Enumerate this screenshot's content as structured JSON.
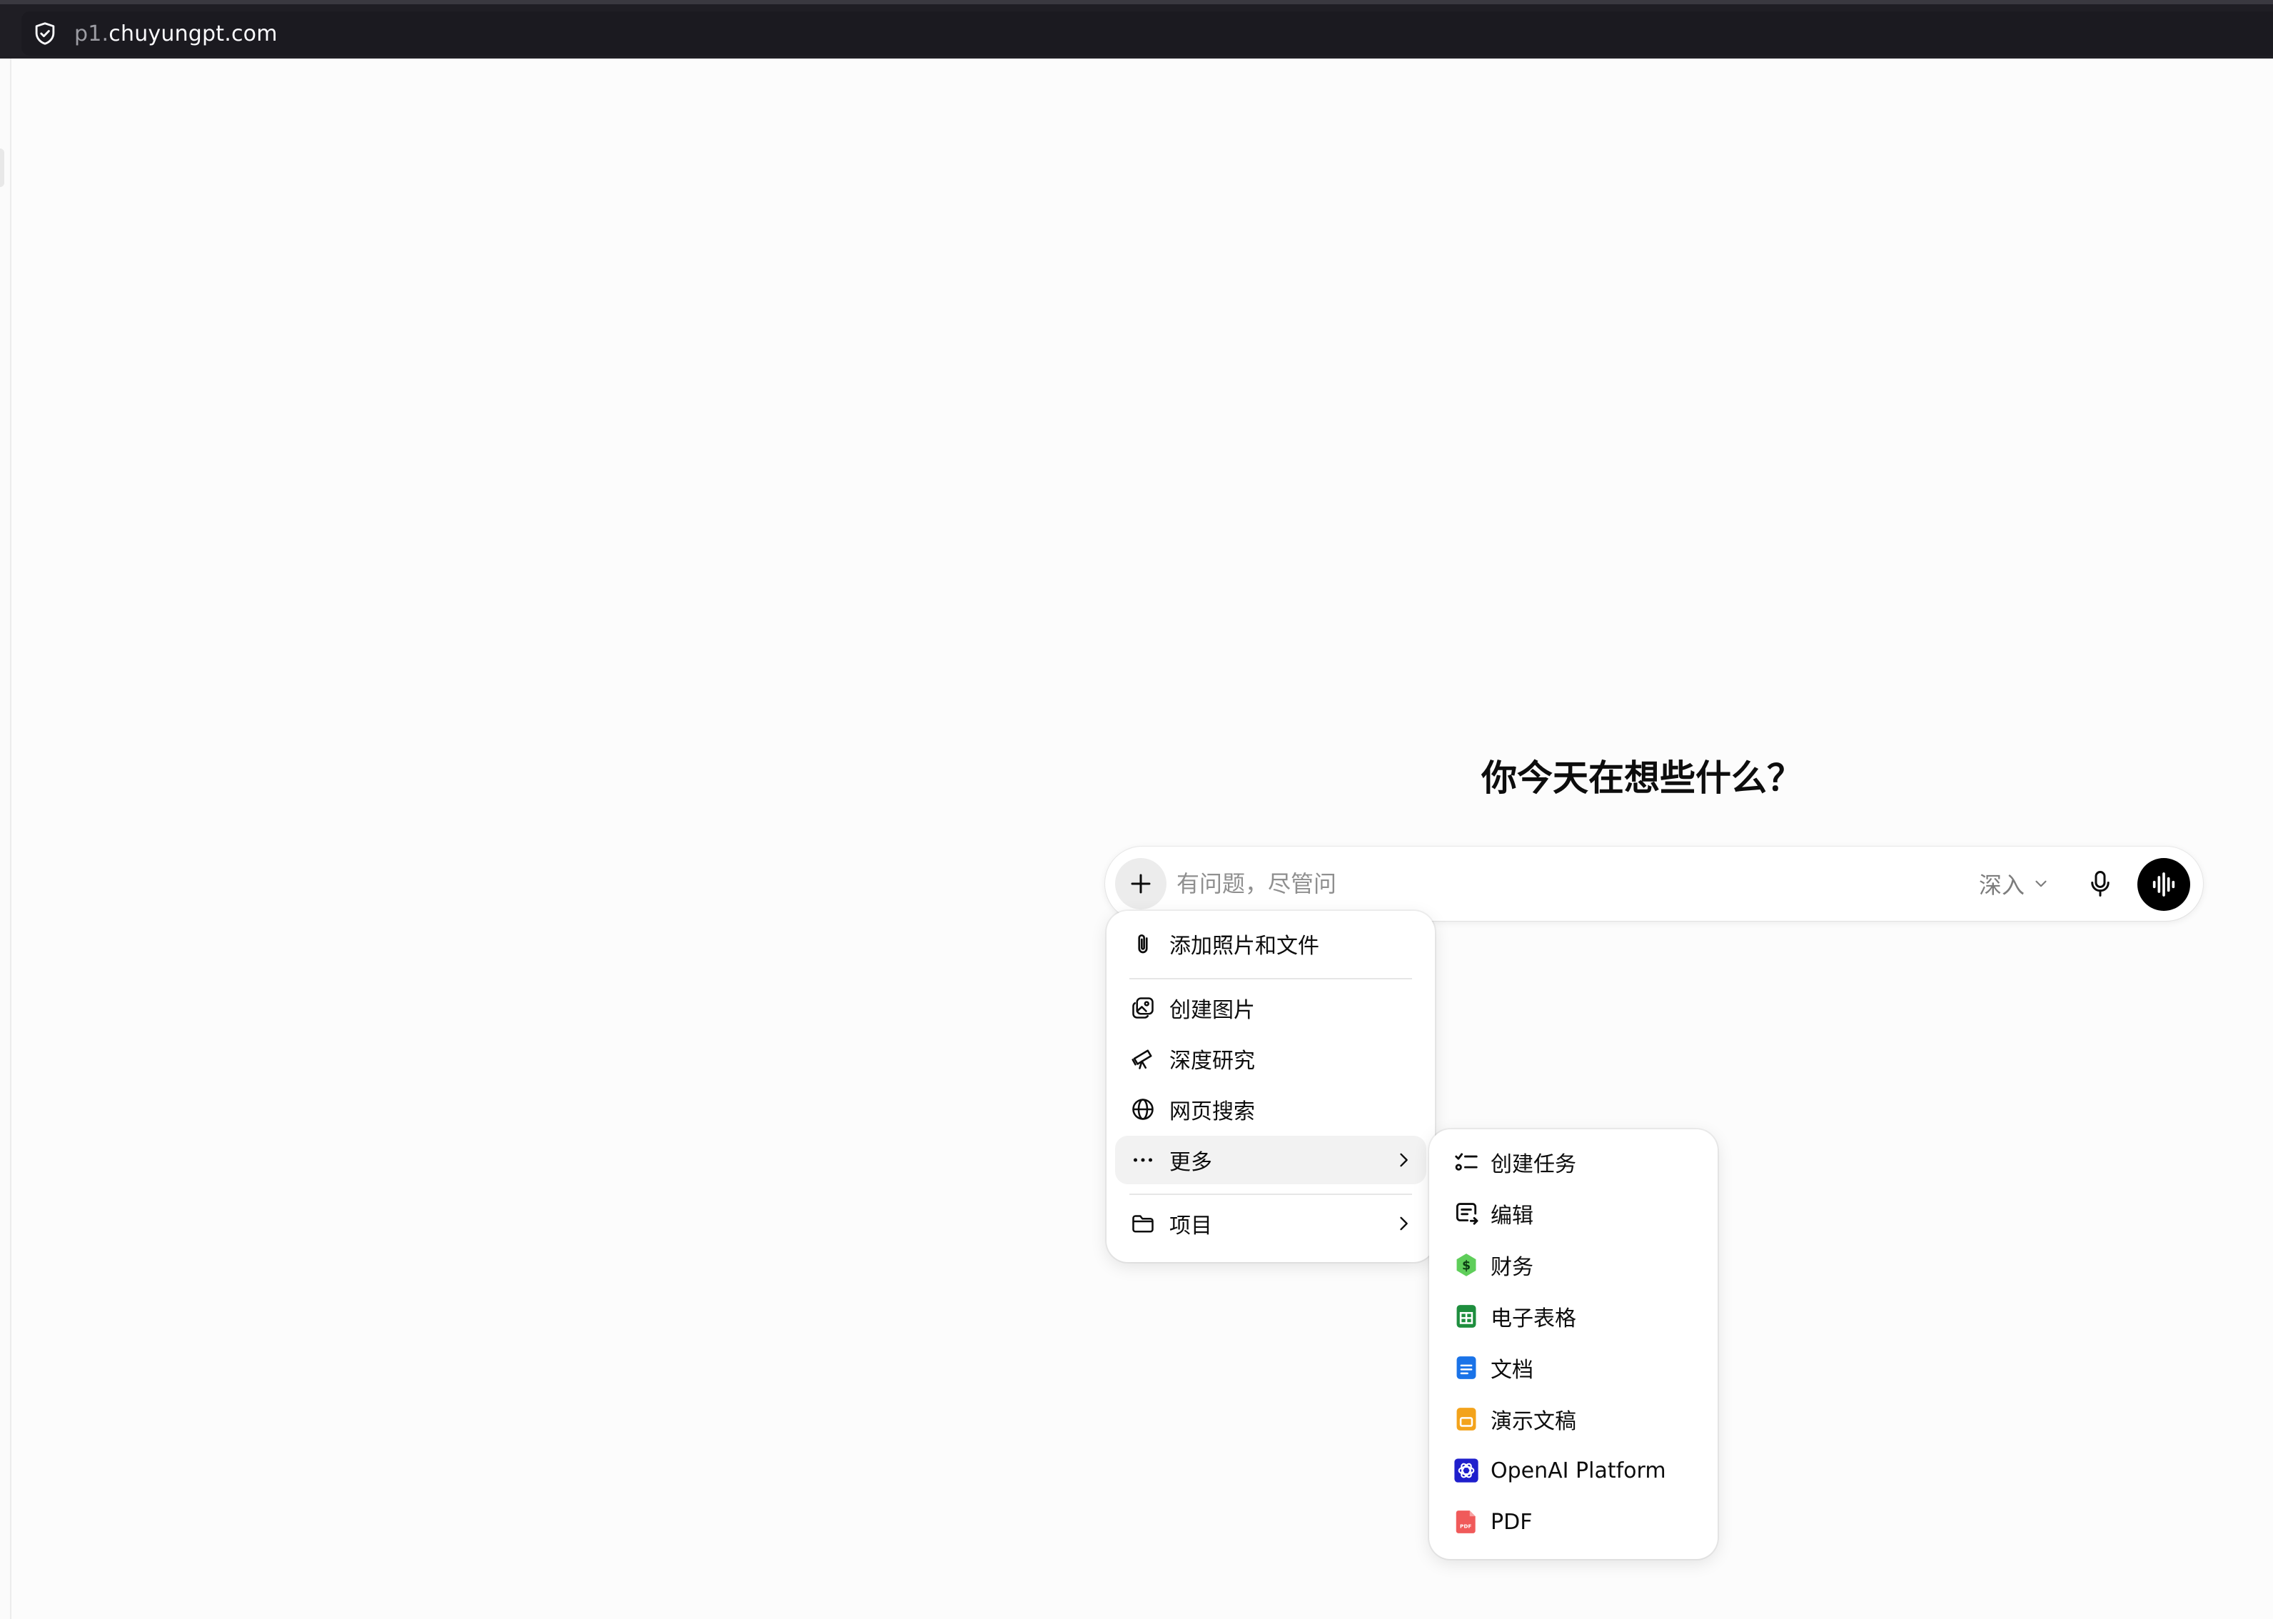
{
  "browser": {
    "url_prefix": "p1.",
    "url_domain": "chuyungpt.com"
  },
  "main": {
    "headline": "你今天在想些什么？"
  },
  "composer": {
    "placeholder": "有问题，尽管问",
    "model_label": "深入"
  },
  "attach_menu": {
    "items": [
      {
        "label": "添加照片和文件",
        "icon": "paperclip-icon"
      },
      {
        "label": "创建图片",
        "icon": "image-create-icon"
      },
      {
        "label": "深度研究",
        "icon": "telescope-icon"
      },
      {
        "label": "网页搜索",
        "icon": "globe-icon"
      },
      {
        "label": "更多",
        "icon": "more-dots-icon"
      },
      {
        "label": "项目",
        "icon": "folder-icon"
      }
    ]
  },
  "more_menu": {
    "items": [
      {
        "label": "创建任务",
        "icon": "task-list-icon"
      },
      {
        "label": "编辑",
        "icon": "edit-canvas-icon"
      },
      {
        "label": "财务",
        "icon": "finance-icon",
        "color": "#5fce5a"
      },
      {
        "label": "电子表格",
        "icon": "spreadsheet-icon",
        "color": "#1e8e3e"
      },
      {
        "label": "文档",
        "icon": "document-icon",
        "color": "#1a73e8"
      },
      {
        "label": "演示文稿",
        "icon": "slides-icon",
        "color": "#f3a31b"
      },
      {
        "label": "OpenAI Platform",
        "icon": "openai-icon",
        "color": "#1f1fcc"
      },
      {
        "label": "PDF",
        "icon": "pdf-icon",
        "color": "#f05a5a"
      }
    ]
  }
}
